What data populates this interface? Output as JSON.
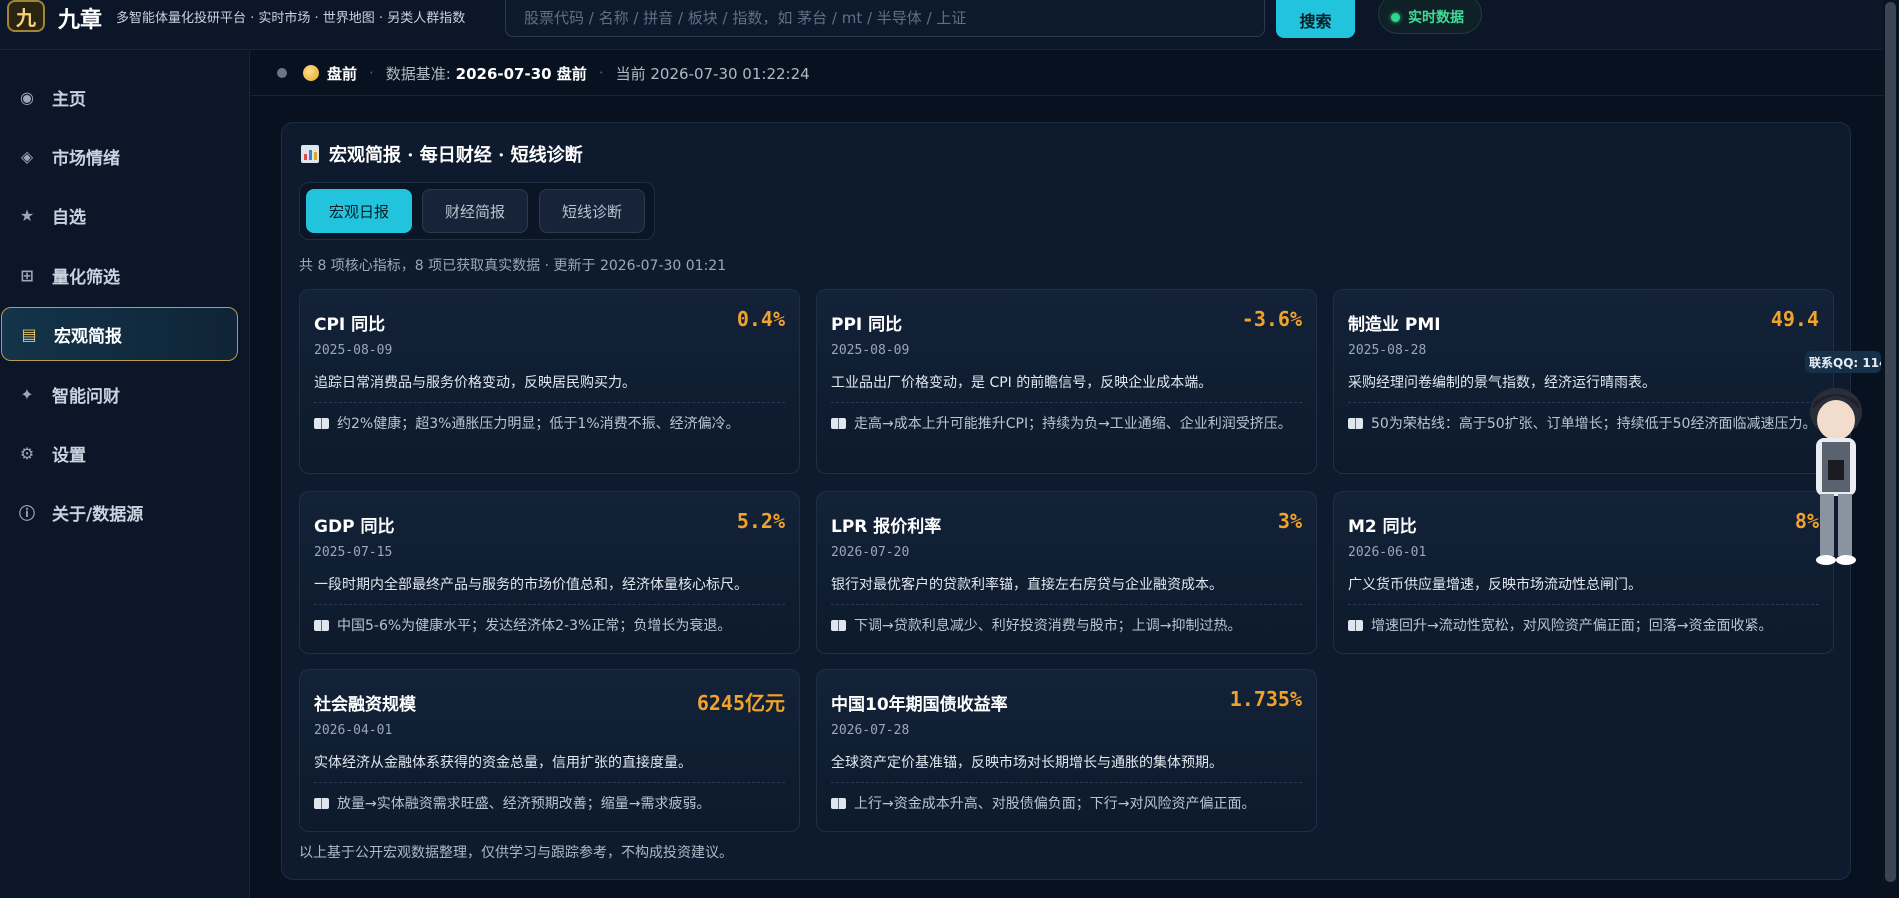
{
  "header": {
    "logo_char": "九",
    "brand": "九章",
    "tagline": "多智能体量化投研平台 · 实时市场 · 世界地图 · 另类人群指数",
    "search_placeholder": "股票代码 / 名称 / 拼音 / 板块 / 指数，如 茅台 / mt / 半导体 / 上证",
    "search_button": "搜索",
    "realtime_badge": "实时数据"
  },
  "sidebar": {
    "items": [
      {
        "icon": "◉",
        "label": "主页"
      },
      {
        "icon": "◈",
        "label": "市场情绪"
      },
      {
        "icon": "★",
        "label": "自选"
      },
      {
        "icon": "⊞",
        "label": "量化筛选"
      },
      {
        "icon": "▤",
        "label": "宏观简报"
      },
      {
        "icon": "✦",
        "label": "智能问财"
      },
      {
        "icon": "⚙",
        "label": "设置"
      },
      {
        "icon": "ⓘ",
        "label": "关于/数据源"
      }
    ]
  },
  "status": {
    "session": "盘前",
    "basis_label": "数据基准:",
    "basis_value": "2026-07-30 盘前",
    "current": "当前 2026-07-30 01:22:24"
  },
  "panel": {
    "title": "宏观简报 · 每日财经 · 短线诊断",
    "tabs": [
      "宏观日报",
      "财经简报",
      "短线诊断"
    ],
    "summary": "共 8 项核心指标，8 项已获取真实数据 · 更新于 2026-07-30 01:21",
    "cards": [
      {
        "title": "CPI 同比",
        "value": "0.4%",
        "date": "2025-08-09",
        "desc": "追踪日常消费品与服务价格变动，反映居民购买力。",
        "note": "约2%健康；超3%通胀压力明显；低于1%消费不振、经济偏冷。"
      },
      {
        "title": "PPI 同比",
        "value": "-3.6%",
        "date": "2025-08-09",
        "desc": "工业品出厂价格变动，是 CPI 的前瞻信号，反映企业成本端。",
        "note": "走高→成本上升可能推升CPI；持续为负→工业通缩、企业利润受挤压。"
      },
      {
        "title": "制造业 PMI",
        "value": "49.4",
        "date": "2025-08-28",
        "desc": "采购经理问卷编制的景气指数，经济运行晴雨表。",
        "note": "50为荣枯线：高于50扩张、订单增长；持续低于50经济面临减速压力。"
      },
      {
        "title": "GDP 同比",
        "value": "5.2%",
        "date": "2025-07-15",
        "desc": "一段时期内全部最终产品与服务的市场价值总和，经济体量核心标尺。",
        "note": "中国5-6%为健康水平；发达经济体2-3%正常；负增长为衰退。"
      },
      {
        "title": "LPR 报价利率",
        "value": "3%",
        "date": "2026-07-20",
        "desc": "银行对最优客户的贷款利率锚，直接左右房贷与企业融资成本。",
        "note": "下调→贷款利息减少、利好投资消费与股市；上调→抑制过热。"
      },
      {
        "title": "M2 同比",
        "value": "8%",
        "date": "2026-06-01",
        "desc": "广义货币供应量增速，反映市场流动性总闸门。",
        "note": "增速回升→流动性宽松，对风险资产偏正面；回落→资金面收紧。"
      },
      {
        "title": "社会融资规模",
        "value": "6245亿元",
        "date": "2026-04-01",
        "desc": "实体经济从金融体系获得的资金总量，信用扩张的直接度量。",
        "note": "放量→实体融资需求旺盛、经济预期改善；缩量→需求疲弱。"
      },
      {
        "title": "中国10年期国债收益率",
        "value": "1.735%",
        "date": "2026-07-28",
        "desc": "全球资产定价基准锚，反映市场对长期增长与通胀的集体预期。",
        "note": "上行→资金成本升高、对股债偏负面；下行→对风险资产偏正面。"
      }
    ],
    "footer": "以上基于公开宏观数据整理，仅供学习与跟踪参考，不构成投资建议。"
  },
  "widget": {
    "qq_label": "联系QQ: 114"
  }
}
